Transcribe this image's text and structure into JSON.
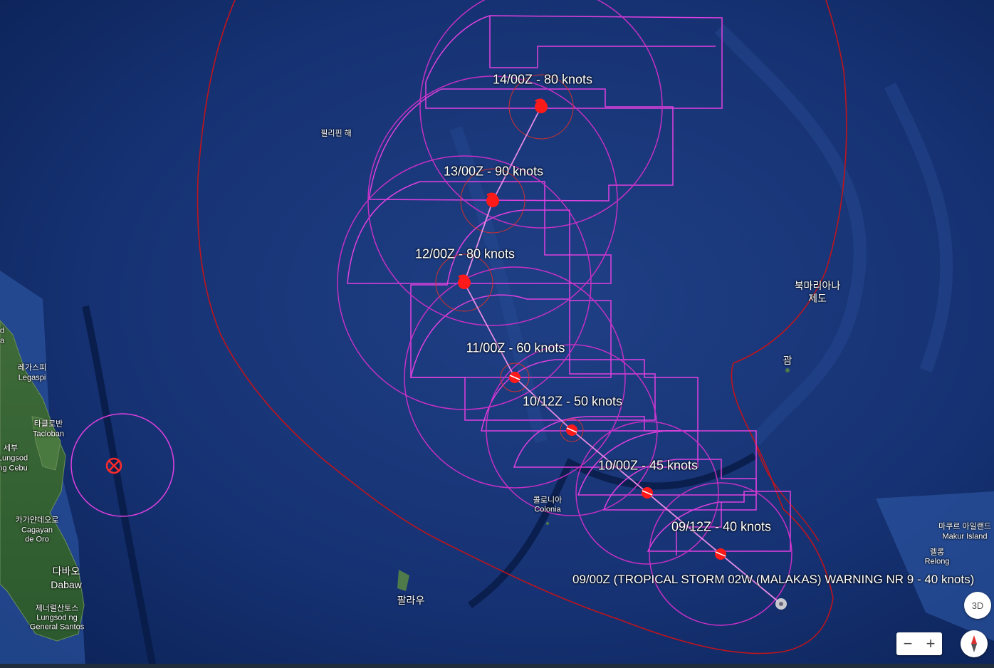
{
  "forecast_points": [
    {
      "label": "14/00Z - 80 knots"
    },
    {
      "label": "13/00Z - 90 knots"
    },
    {
      "label": "12/00Z - 80 knots"
    },
    {
      "label": "11/00Z - 60 knots"
    },
    {
      "label": "10/12Z - 50 knots"
    },
    {
      "label": "10/00Z - 45 knots"
    },
    {
      "label": "09/12Z - 40 knots"
    }
  ],
  "warning_label": "09/00Z (TROPICAL STORM 02W (MALAKAS) WARNING NR 9    - 40 knots)",
  "places": {
    "philippine_sea": "필리핀 해",
    "northern_mariana_1": "북마리아나",
    "northern_mariana_2": "제도",
    "guam": "괌",
    "legaspi_ko": "레가스피",
    "legaspi": "Legaspi",
    "tacloban_ko": "타클로반",
    "tacloban": "Tacloban",
    "cebu_ko": "세부",
    "cebu_1": "Lungsod",
    "cebu_2": "ng Cebu",
    "cagayan_ko": "카가얀데오로",
    "cagayan_1": "Cagayan",
    "cagayan_2": "de Oro",
    "davao_ko": "다바오",
    "davao": "Dabaw",
    "gensan_ko": "제너럴산토스",
    "gensan_1": "Lungsod ng",
    "gensan_2": "General Santos",
    "colonia_ko": "콜로니아",
    "colonia": "Colonia",
    "palau": "팔라우",
    "makur_ko": "마쿠르 아일랜드",
    "makur": "Makur Island",
    "relong_ko": "렐롱",
    "relong": "Relong",
    "edge_1": "d",
    "edge_2": "a"
  },
  "controls": {
    "btn_3d": "3D",
    "zoom_out": "−",
    "zoom_in": "+"
  },
  "colors": {
    "track": "#e040e0",
    "danger_area": "#c0141c",
    "storm_icon": "#ff1a1a"
  }
}
